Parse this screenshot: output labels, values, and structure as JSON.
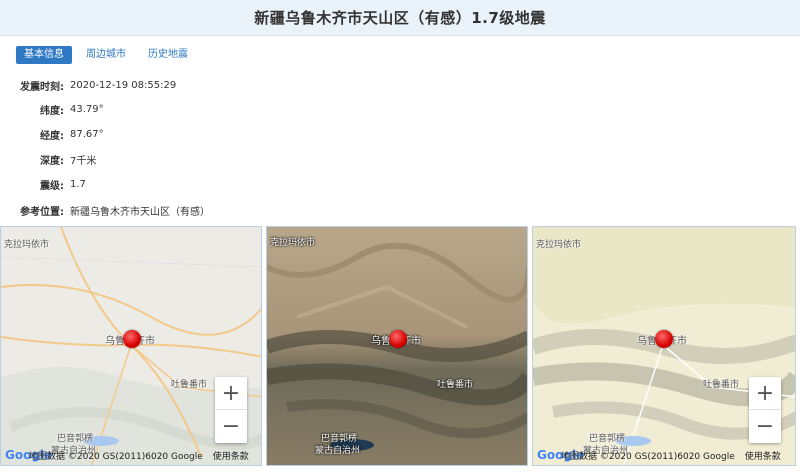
{
  "page": {
    "title": "新疆乌鲁木齐市天山区（有感）1.7级地震"
  },
  "tabs": [
    {
      "label": "基本信息",
      "active": true
    },
    {
      "label": "周边城市",
      "active": false
    },
    {
      "label": "历史地震",
      "active": false
    }
  ],
  "info": {
    "time_label": "发震时刻:",
    "time_value": "2020-12-19 08:55:29",
    "lat_label": "纬度:",
    "lat_value": "43.79°",
    "lon_label": "经度:",
    "lon_value": "87.67°",
    "depth_label": "深度:",
    "depth_value": "7千米",
    "mag_label": "震级:",
    "mag_value": "1.7",
    "loc_label": "参考位置:",
    "loc_value": "新疆乌鲁木齐市天山区（有感）"
  },
  "maps": {
    "labels": {
      "karamay": "克拉玛依市",
      "urumqi": "乌鲁木齐市",
      "turpan": "吐鲁番市",
      "bayingol_1": "巴音郭楞",
      "bayingol_2": "蒙古自治州"
    },
    "attribution": "地图数据 ©2020 GS(2011)6020 Google",
    "terms": "使用条款",
    "zoom_in": "+",
    "zoom_out": "−",
    "google_logo": "Google",
    "colors": {
      "marker": "#d60000",
      "tab_active": "#2f78c4",
      "title_bg": "#eaf3fa"
    }
  }
}
